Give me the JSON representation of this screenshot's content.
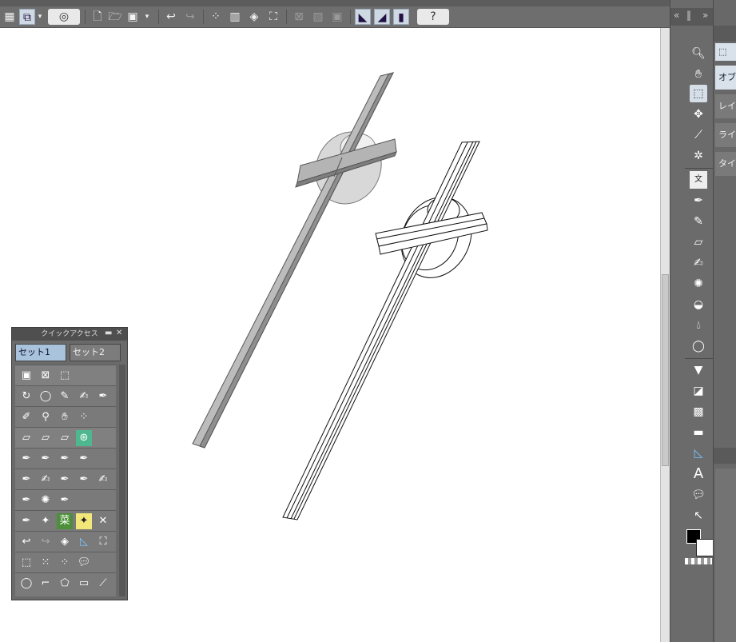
{
  "toolbar": {
    "save_icon": "save-icon",
    "undo": "↩",
    "redo": "↪",
    "help": "?"
  },
  "tool_palette": {
    "tools": [
      "zoom",
      "hand",
      "object",
      "move",
      "eyedropper",
      "sparkle",
      "text-box",
      "pen",
      "marker",
      "eraser",
      "brush",
      "airbrush",
      "blend",
      "water",
      "lasso",
      "fill",
      "gradient",
      "tone",
      "ruler",
      "ruler-triangle",
      "text",
      "balloon",
      "correction",
      "color"
    ]
  },
  "right_panel": {
    "tabs": [
      "オブジ",
      "レイヤ",
      "ライト",
      "タイム"
    ]
  },
  "quick_access": {
    "title": "クイックアクセス",
    "tabs": [
      "セット1",
      "セット2"
    ],
    "special_labels": [
      "菜"
    ]
  },
  "colors": {
    "accent": "#a9c3dc",
    "panel": "#6b6b6b",
    "canvas": "#ffffff"
  }
}
